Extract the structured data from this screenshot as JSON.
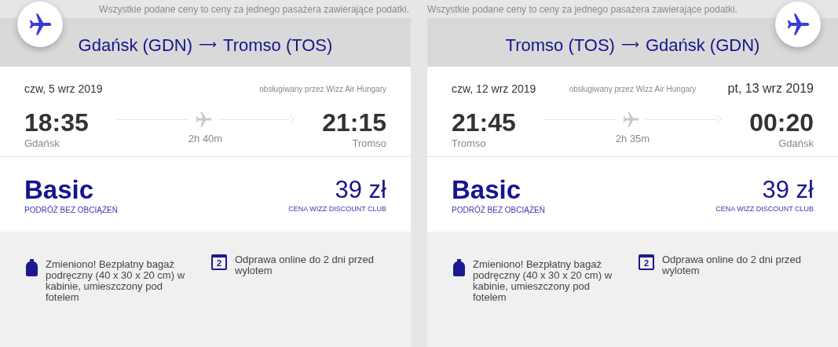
{
  "flights": [
    {
      "kind": "outbound",
      "notice": "Wszystkie podane ceny to ceny za jednego pasażera zawierające podatki.",
      "route": {
        "from": "Gdańsk (GDN)",
        "arrow": "⟶",
        "to": "Tromso (TOS)"
      },
      "departure_date": "czw, 5 wrz 2019",
      "operator": "obsługiwany przez Wizz Air Hungary",
      "departure_time": "18:35",
      "duration": "2h 40m",
      "arrival_time": "21:15",
      "departure_city": "Gdańsk",
      "arrival_city": "Tromso",
      "fare": {
        "name": "Basic",
        "subtitle": "PODRÓŻ BEZ OBCIĄŻEŃ",
        "price": "39 zł",
        "price_note": "CENA WIZZ DISCOUNT CLUB"
      },
      "perks": [
        {
          "kind": "bag",
          "text": "Zmieniono! Bezpłatny bagaż podręczny (40 x 30 x 20 cm) w kabinie, umieszczony pod fotelem"
        },
        {
          "kind": "calendar",
          "day": "2",
          "text": "Odprawa online do 2 dni przed wylotem"
        }
      ]
    },
    {
      "kind": "return",
      "notice": "Wszystkie podane ceny to ceny za jednego pasażera zawierające podatki.",
      "route": {
        "from": "Tromso (TOS)",
        "arrow": "⟶",
        "to": "Gdańsk (GDN)"
      },
      "departure_date": "czw, 12 wrz 2019",
      "operator": "obsługiwany przez Wizz Air Hungary",
      "arrival_date": "pt, 13 wrz 2019",
      "departure_time": "21:45",
      "duration": "2h 35m",
      "arrival_time": "00:20",
      "departure_city": "Tromso",
      "arrival_city": "Gdańsk",
      "fare": {
        "name": "Basic",
        "subtitle": "PODRÓŻ BEZ OBCIĄŻEŃ",
        "price": "39 zł",
        "price_note": "CENA WIZZ DISCOUNT CLUB"
      },
      "perks": [
        {
          "kind": "bag",
          "text": "Zmieniono! Bezpłatny bagaż podręczny (40 x 30 x 20 cm) w kabinie, umieszczony pod fotelem"
        },
        {
          "kind": "calendar",
          "day": "2",
          "text": "Odprawa online do 2 dni przed wylotem"
        }
      ]
    }
  ]
}
